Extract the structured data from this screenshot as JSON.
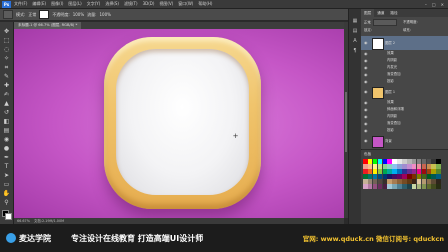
{
  "menu": {
    "app_badge": "Ps",
    "items": [
      "文件(F)",
      "编辑(E)",
      "图像(I)",
      "图层(L)",
      "文字(Y)",
      "选择(S)",
      "滤镜(T)",
      "3D(D)",
      "视图(V)",
      "窗口(W)",
      "帮助(H)"
    ],
    "window_controls": [
      "–",
      "□",
      "✕"
    ]
  },
  "options": {
    "mode_label": "模式:",
    "mode_value": "正常",
    "opacity_label": "不透明度:",
    "opacity_value": "100%",
    "flow_label": "流量:",
    "flow_value": "100%"
  },
  "document": {
    "tab_title": "未标题-1 @ 66.7% (图层, RGB/8) *"
  },
  "status": {
    "zoom": "66.67%",
    "doc_info": "文档:2.19M/1.00M"
  },
  "layers_panel": {
    "tabs": [
      "图层",
      "通道",
      "路径"
    ],
    "blend_label": "正常",
    "opacity_label": "不透明度:",
    "lock_label": "锁定:",
    "fill_label": "填充:",
    "rows": [
      {
        "label": "图层 2",
        "type": "big",
        "thumb_color": "#ffffff",
        "selected": true
      },
      {
        "label": "效果",
        "type": "sub"
      },
      {
        "label": "内阴影",
        "type": "sub"
      },
      {
        "label": "内发光",
        "type": "sub"
      },
      {
        "label": "渐变叠加",
        "type": "sub"
      },
      {
        "label": "投影",
        "type": "sub"
      },
      {
        "label": "图层 1",
        "type": "big",
        "thumb_color": "#f0c46c",
        "selected": false
      },
      {
        "label": "效果",
        "type": "sub"
      },
      {
        "label": "斜面和浮雕",
        "type": "sub"
      },
      {
        "label": "内阴影",
        "type": "sub"
      },
      {
        "label": "渐变叠加",
        "type": "sub"
      },
      {
        "label": "投影",
        "type": "sub"
      },
      {
        "label": "背景",
        "type": "big",
        "thumb_color": "#c556c6",
        "selected": false
      }
    ]
  },
  "swatches_panel": {
    "title": "色板",
    "colors": [
      "#ff0000",
      "#ffff00",
      "#00ff00",
      "#00ffff",
      "#0000ff",
      "#ff00ff",
      "#ffffff",
      "#e6e6e6",
      "#cccccc",
      "#b3b3b3",
      "#999999",
      "#808080",
      "#666666",
      "#4d4d4d",
      "#333333",
      "#000000",
      "#f4a08c",
      "#f8c08c",
      "#fff48c",
      "#c4e08c",
      "#8cd08c",
      "#8cd0c4",
      "#8cc4f0",
      "#8ca0d8",
      "#a08cd0",
      "#c48cd0",
      "#f08cc4",
      "#f08ca0",
      "#c86450",
      "#c88c50",
      "#c8c050",
      "#80b050",
      "#ed1c24",
      "#f26522",
      "#fff200",
      "#8dc63f",
      "#00a651",
      "#00a99d",
      "#00aeef",
      "#0072bc",
      "#2e3192",
      "#662d91",
      "#92278f",
      "#ec008c",
      "#9e0b0f",
      "#a0410d",
      "#aba000",
      "#598527",
      "#007236",
      "#00746b",
      "#0076a3",
      "#004a80",
      "#003471",
      "#1b1464",
      "#440e62",
      "#630460",
      "#9e005d",
      "#790000",
      "#7b2e00",
      "#827b00",
      "#406618",
      "#005e20",
      "#005952",
      "#005b7f",
      "#c7b299",
      "#998675",
      "#736357",
      "#534741",
      "#37302d",
      "#c69c6d",
      "#a67c52",
      "#8c6239",
      "#754c24",
      "#603913",
      "#3c2415",
      "#e2c7a1",
      "#b59a72",
      "#8a6e4b",
      "#5c4a34",
      "#2e251a",
      "#d7a3c8",
      "#b57aa6",
      "#935080",
      "#6b2d5e",
      "#4a1f42",
      "#a3c8d7",
      "#7aa6b5",
      "#508093",
      "#2d5e6b",
      "#1f424a",
      "#c8d7a3",
      "#a6b57a",
      "#809350",
      "#5e6b2d",
      "#424a1f",
      "#282d13"
    ]
  },
  "footer": {
    "brand": "麦达学院",
    "slogan": "专注设计在线教育  打造高端UI设计师",
    "site": "官网: www.qduck.cn  微信订阅号: qduckcn"
  }
}
